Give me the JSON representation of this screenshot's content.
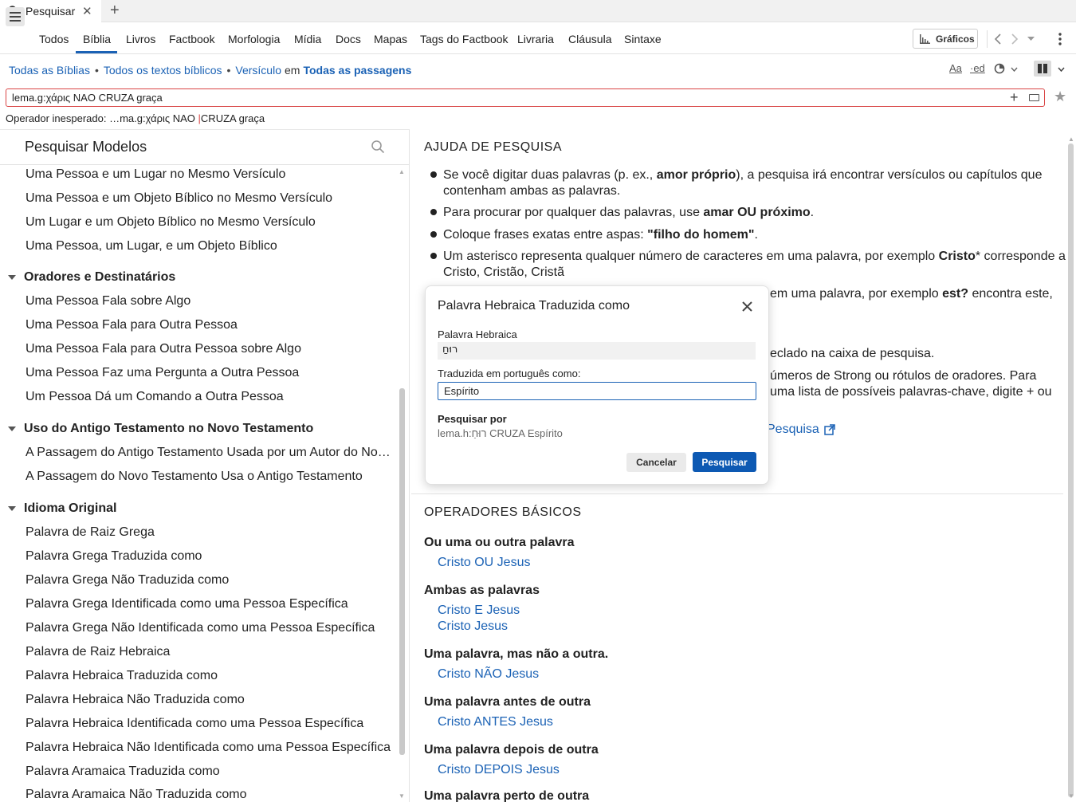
{
  "tab": {
    "title": "Pesquisar",
    "close": "✕",
    "new": "+"
  },
  "nav": {
    "tabs": [
      "Todos",
      "Bíblia",
      "Livros",
      "Factbook",
      "Morfologia",
      "Mídia",
      "Docs",
      "Mapas",
      "Tags do Factbook",
      "Livraria",
      "Cláusula",
      "Sintaxe"
    ],
    "graficos": "Gráficos"
  },
  "scope": {
    "bibles": "Todas as Bíblias",
    "texts": "Todos os textos bíblicos",
    "unit": "Versículo",
    "em": "em",
    "passages": "Todas as passagens"
  },
  "tools": {
    "font": "Aa",
    "ed": "·ed"
  },
  "search": {
    "value": "lema.g:χάρις NAO CRUZA graça",
    "error_prefix": "Operador inesperado: …ma.g:χάρις NAO ",
    "error_caret": "|",
    "error_suffix": "CRUZA graça"
  },
  "left": {
    "title": "Pesquisar Modelos",
    "items_top": [
      "Uma Pessoa e um Lugar no Mesmo Versículo",
      "Uma Pessoa e um Objeto Bíblico no Mesmo Versículo",
      "Um Lugar e um Objeto Bíblico no Mesmo Versículo",
      "Uma Pessoa, um Lugar, e um Objeto Bíblico"
    ],
    "group1": "Oradores e Destinatários",
    "items_g1": [
      "Uma Pessoa Fala sobre Algo",
      "Uma Pessoa Fala para Outra Pessoa",
      "Uma Pessoa Fala para Outra Pessoa sobre Algo",
      "Uma Pessoa Faz uma Pergunta a Outra Pessoa",
      "Um Pessoa Dá um Comando a Outra Pessoa"
    ],
    "group2": "Uso do Antigo Testamento no Novo Testamento",
    "items_g2": [
      "A Passagem do Antigo Testamento Usada por um Autor do Novo Testamento",
      "A Passagem do Novo Testamento Usa o Antigo Testamento"
    ],
    "group3": "Idioma Original",
    "items_g3": [
      "Palavra de Raiz Grega",
      "Palavra Grega Traduzida como",
      "Palavra Grega Não Traduzida como",
      "Palavra Grega Identificada como uma Pessoa Específica",
      "Palavra Grega Não Identificada como uma Pessoa Específica",
      "Palavra de Raiz Hebraica",
      "Palavra Hebraica Traduzida como",
      "Palavra Hebraica Não Traduzida como",
      "Palavra Hebraica Identificada como uma Pessoa Específica",
      "Palavra Hebraica Não Identificada como uma Pessoa Específica",
      "Palavra Aramaica Traduzida como",
      "Palavra Aramaica Não Traduzida como"
    ]
  },
  "help": {
    "title": "AJUDA DE PESQUISA",
    "b1_pre": "Se você digitar duas palavras (p. ex., ",
    "b1_bold": "amor próprio",
    "b1_post": "), a pesquisa irá encontrar versículos ou capítulos que",
    "b1_line2": "contenham ambas as palavras.",
    "b2_pre": "Para procurar por qualquer das palavras, use ",
    "b2_bold": "amar OU próximo",
    "b2_post": ".",
    "b3_pre": "Coloque frases exatas entre aspas: ",
    "b3_bold": "\"filho do homem\"",
    "b3_post": ".",
    "b4_pre": "Um asterisco representa qualquer número de caracteres em uma palavra, por exemplo ",
    "b4_bold": "Cristo",
    "b4_post": "* corresponde a",
    "b4_line2": "Cristo, Cristão, Cristã",
    "b5_pre": "em uma palavra, por exemplo ",
    "b5_bold": "est?",
    "b5_post": " encontra este,",
    "b6_frag": "eclado na caixa de pesquisa.",
    "b7_frag1": "úmeros de Strong ou rótulos de oradores. Para",
    "b7_frag2": "uma lista de possíveis palavras-chave, digite + ou",
    "link_frag": "Pesquisa"
  },
  "basic": {
    "title": "OPERADORES BÁSICOS",
    "h1": "Ou uma ou outra palavra",
    "l1": "Cristo OU Jesus",
    "h2": "Ambas as palavras",
    "l2a": "Cristo E Jesus",
    "l2b": "Cristo Jesus",
    "h3": "Uma palavra, mas não a outra.",
    "l3": "Cristo NÃO Jesus",
    "h4": "Uma palavra antes de outra",
    "l4": "Cristo ANTES Jesus",
    "h5": "Uma palavra depois de outra",
    "l5": "Cristo DEPOIS Jesus",
    "h6": "Uma palavra perto de outra"
  },
  "dialog": {
    "title": "Palavra Hebraica Traduzida como",
    "label_hebrew": "Palavra Hebraica",
    "hebrew_value": "רוּחַ",
    "label_translated": "Traduzida em português como:",
    "translated_value": "Espírito",
    "search_by_label": "Pesquisar por",
    "search_by_value": "lema.h:רוּחַ CRUZA Espírito",
    "cancel": "Cancelar",
    "submit": "Pesquisar"
  },
  "colors": {
    "accent": "#1b62b5",
    "error": "#d94545",
    "primary_button": "#0d59b3"
  }
}
